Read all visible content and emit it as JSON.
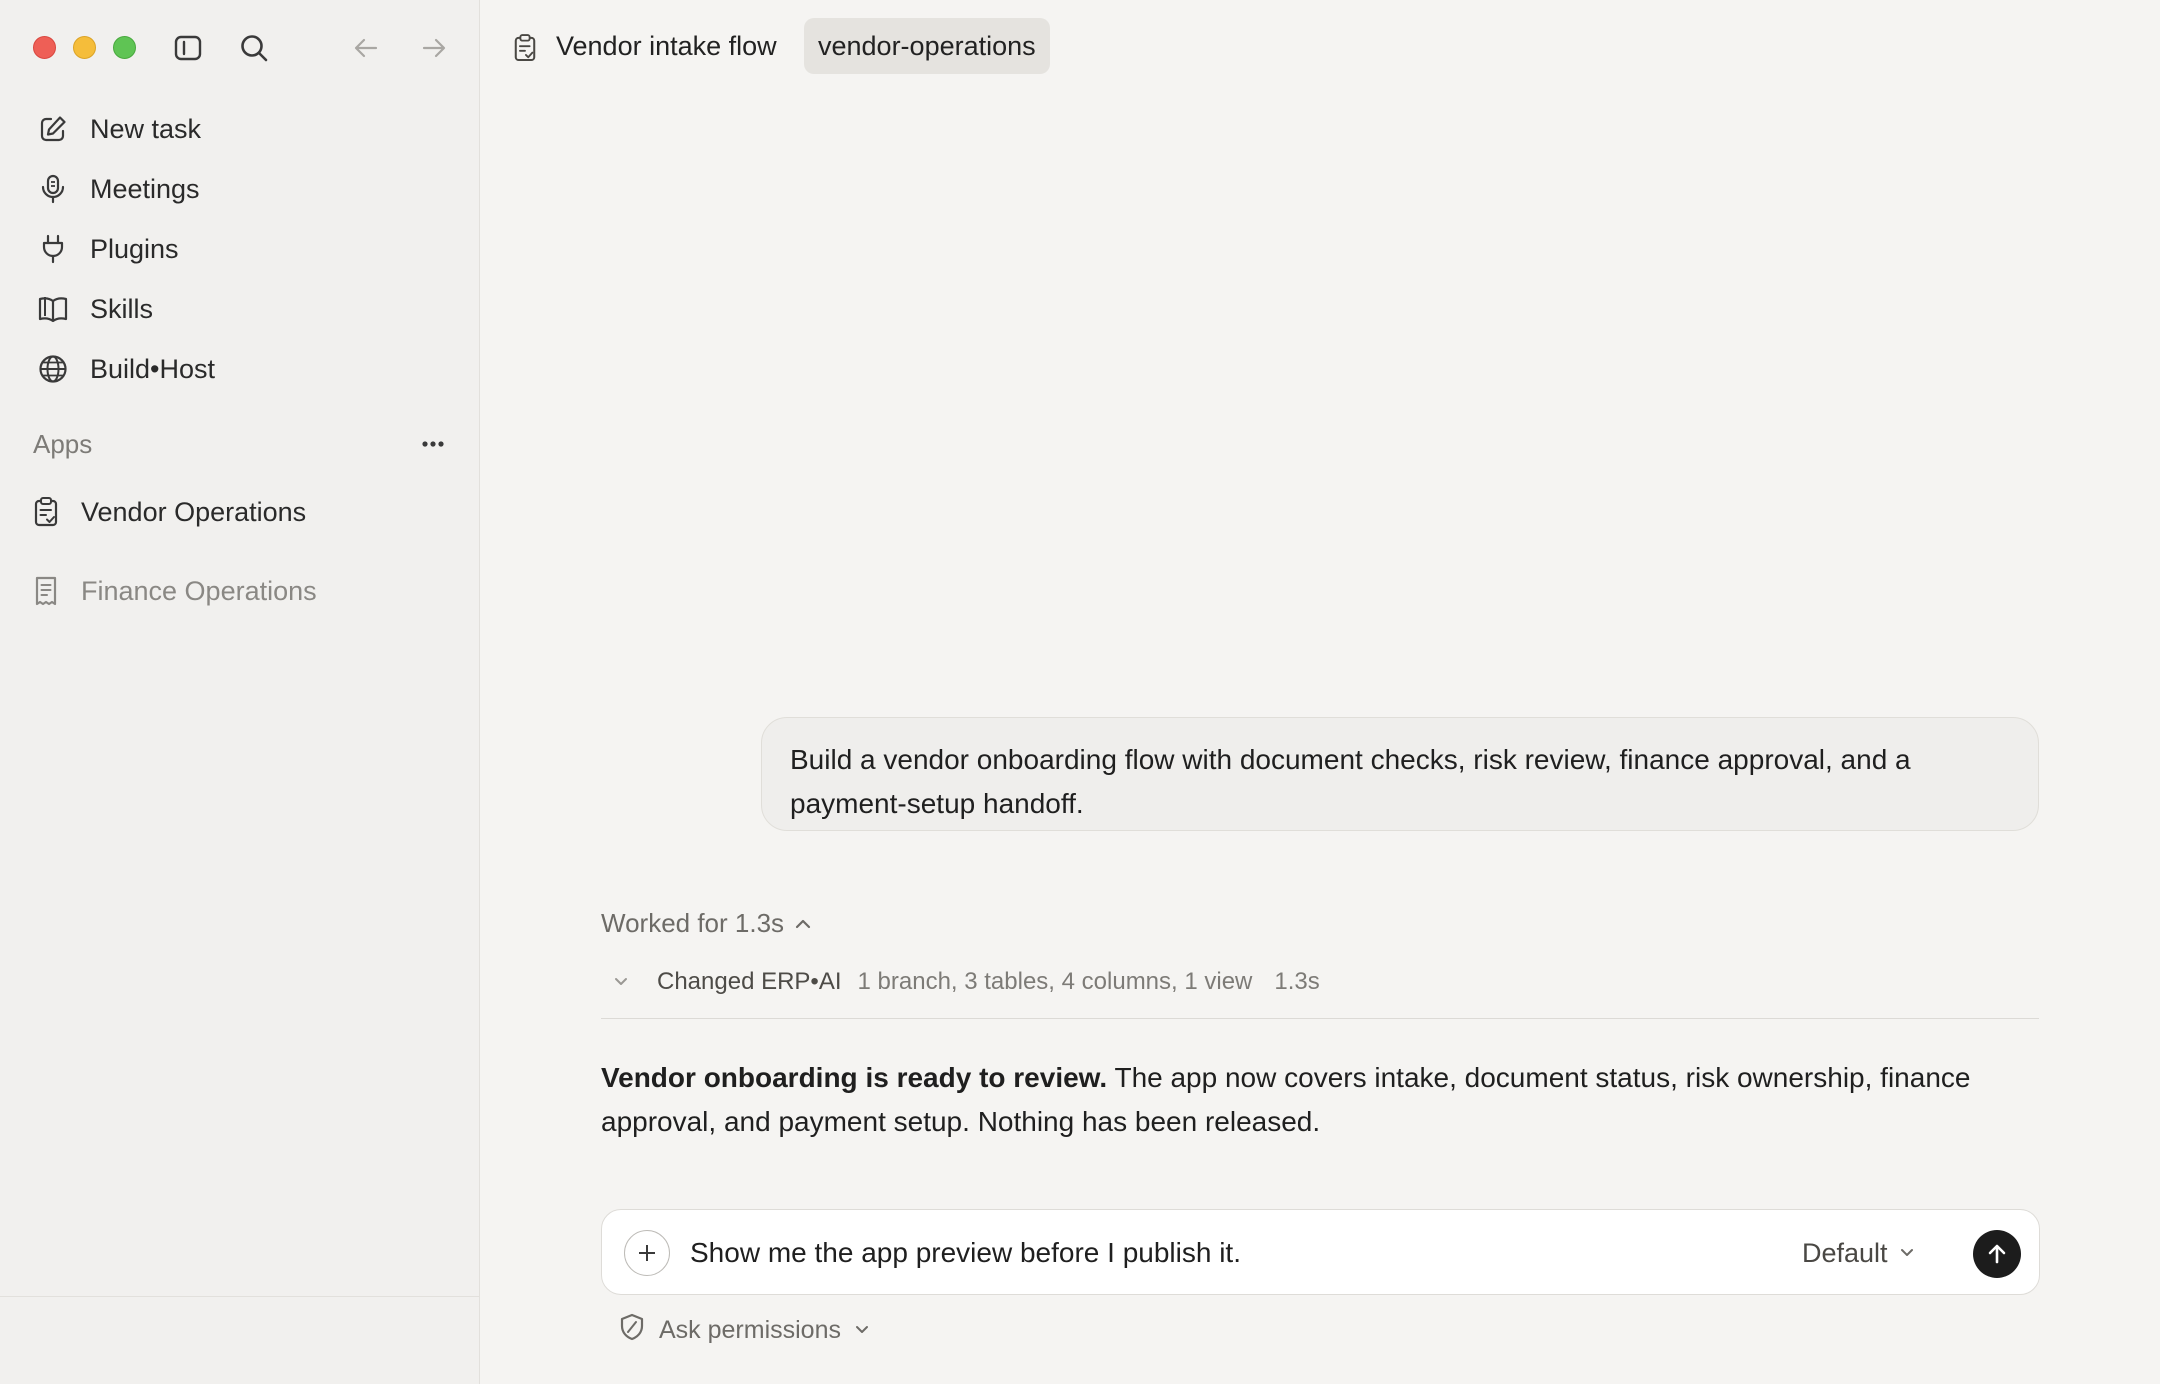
{
  "window": {
    "title": "Vendor intake flow"
  },
  "sidebar": {
    "nav": [
      {
        "label": "New task",
        "icon": "pencil-square-icon"
      },
      {
        "label": "Meetings",
        "icon": "microphone-icon"
      },
      {
        "label": "Plugins",
        "icon": "plug-icon"
      },
      {
        "label": "Skills",
        "icon": "book-icon"
      },
      {
        "label": "Build•Host",
        "icon": "globe-icon"
      }
    ],
    "apps_header": "Apps",
    "apps": [
      {
        "label": "Vendor Operations",
        "icon": "clipboard-check-icon",
        "active": true
      },
      {
        "label": "Finance Operations",
        "icon": "receipt-icon",
        "active": false
      }
    ]
  },
  "header": {
    "title": "Vendor intake flow",
    "project": "vendor-operations"
  },
  "conversation": {
    "user_message": "Build a vendor onboarding flow with document checks, risk review, finance approval, and a payment-setup handoff.",
    "worked_label": "Worked for 1.3s",
    "change": {
      "label": "Changed ERP•AI",
      "detail": "1 branch, 3 tables, 4 columns, 1 view",
      "time": "1.3s"
    },
    "reply_bold": "Vendor onboarding is ready to review.",
    "reply_text": " The app now covers intake, document status, risk ownership, finance approval, and payment setup. Nothing has been released."
  },
  "composer": {
    "value": "Show me the app preview before I publish it.",
    "model": "Default",
    "permissions": "Ask permissions"
  },
  "colors": {
    "sidebar_bg": "#f1f0ee",
    "main_bg": "#f5f4f2",
    "send_button": "#1c1c1c",
    "traffic_red": "#ee5f56",
    "traffic_yellow": "#f5bd3a",
    "traffic_green": "#5fc454"
  }
}
